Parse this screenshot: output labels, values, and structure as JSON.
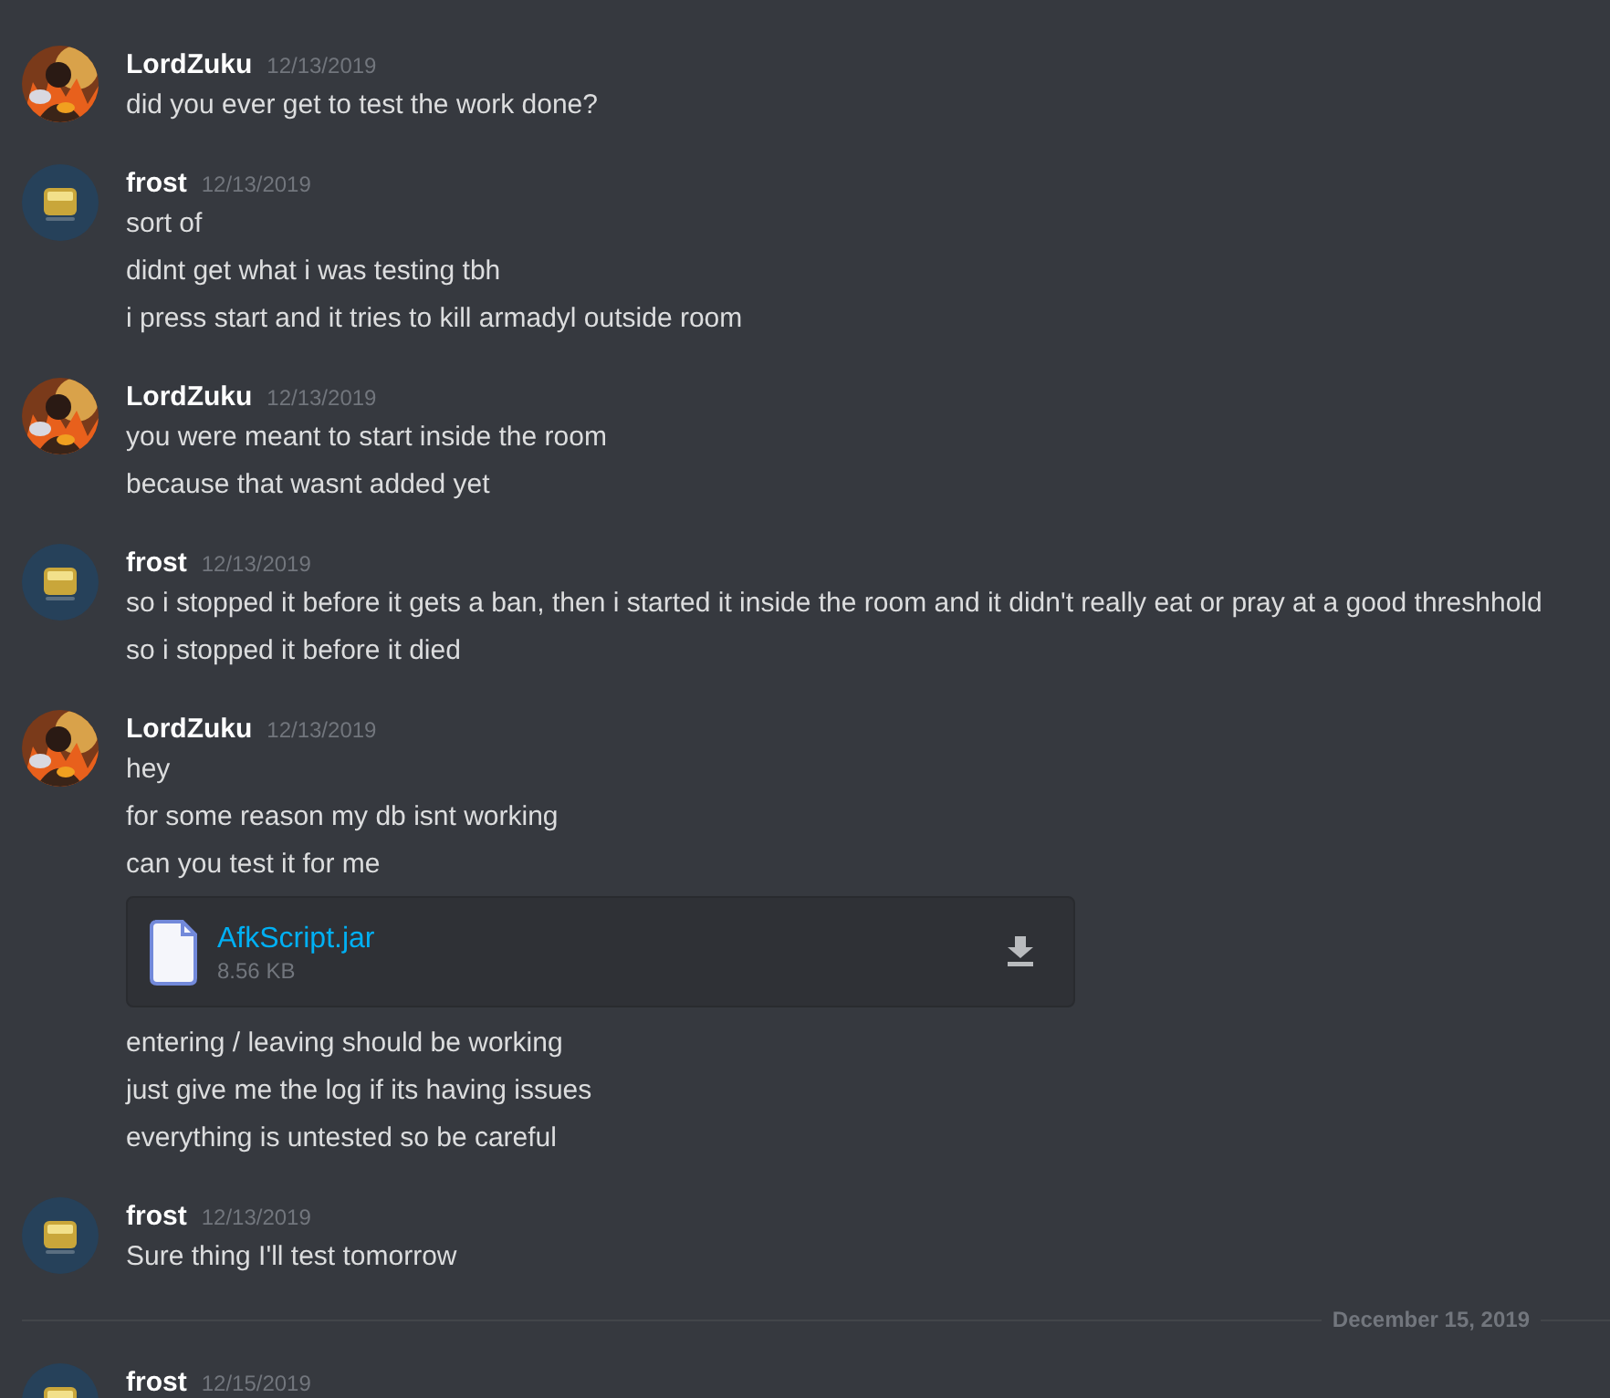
{
  "feed": [
    {
      "kind": "group",
      "author": "LordZuku",
      "avatar": {
        "kind": "fire"
      },
      "time": "12/13/2019",
      "items": [
        {
          "kind": "text",
          "text": "did you ever get to test the work done?"
        }
      ]
    },
    {
      "kind": "group",
      "author": "frost",
      "avatar": {
        "kind": "badge"
      },
      "time": "12/13/2019",
      "items": [
        {
          "kind": "text",
          "text": "sort of"
        },
        {
          "kind": "text",
          "text": "didnt get what i was testing tbh"
        },
        {
          "kind": "text",
          "text": "i press start and it tries to kill armadyl outside room"
        }
      ]
    },
    {
      "kind": "group",
      "author": "LordZuku",
      "avatar": {
        "kind": "fire"
      },
      "time": "12/13/2019",
      "items": [
        {
          "kind": "text",
          "text": "you were meant to start inside the room"
        },
        {
          "kind": "text",
          "text": "because that wasnt added yet"
        }
      ]
    },
    {
      "kind": "group",
      "author": "frost",
      "avatar": {
        "kind": "badge"
      },
      "time": "12/13/2019",
      "items": [
        {
          "kind": "text",
          "text": "so i stopped it before it gets a ban, then i started it inside the room and it didn't really eat or pray at a good threshhold"
        },
        {
          "kind": "text",
          "text": "so i stopped it before it died"
        }
      ]
    },
    {
      "kind": "group",
      "author": "LordZuku",
      "avatar": {
        "kind": "fire"
      },
      "time": "12/13/2019",
      "items": [
        {
          "kind": "text",
          "text": "hey"
        },
        {
          "kind": "text",
          "text": "for some reason my db isnt working"
        },
        {
          "kind": "text",
          "text": "can you test it for me"
        },
        {
          "kind": "file",
          "name": "AfkScript.jar",
          "size": "8.56 KB"
        },
        {
          "kind": "text",
          "text": "entering / leaving should be working"
        },
        {
          "kind": "text",
          "text": "just give me the log if its having issues"
        },
        {
          "kind": "text",
          "text": "everything is untested so be careful"
        }
      ]
    },
    {
      "kind": "group",
      "author": "frost",
      "avatar": {
        "kind": "badge"
      },
      "time": "12/13/2019",
      "items": [
        {
          "kind": "text",
          "text": "Sure thing I'll test tomorrow"
        }
      ]
    },
    {
      "kind": "divider",
      "label": "December 15, 2019"
    },
    {
      "kind": "group",
      "author": "frost",
      "avatar": {
        "kind": "badge"
      },
      "time": "12/15/2019"
    }
  ]
}
